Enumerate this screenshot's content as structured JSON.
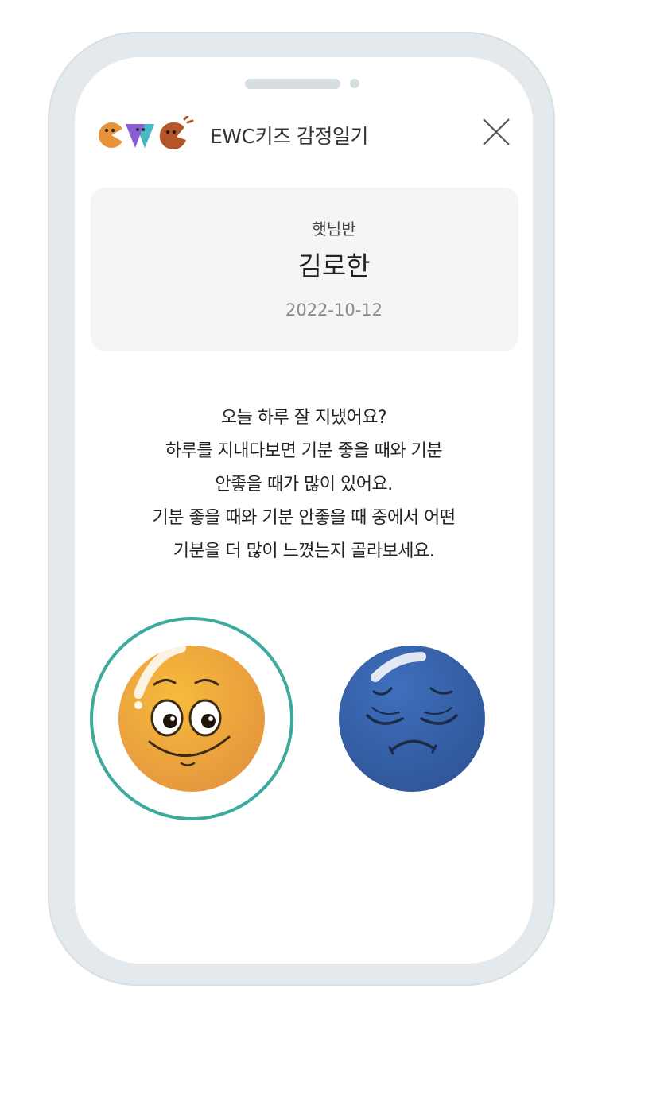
{
  "app": {
    "title": "EWC키즈 감정일기",
    "logo_text": "EWC"
  },
  "profile": {
    "class_name": "햇님반",
    "student_name": "김로한",
    "date": "2022-10-12"
  },
  "question_lines": [
    "오늘 하루 잘 지냈어요?",
    "하루를 지내다보면 기분 좋을 때와 기분",
    "안좋을 때가 많이 있어요.",
    "기분 좋을 때와 기분 안좋을 때 중에서 어떤",
    "기분을 더 많이 느꼈는지 골라보세요."
  ],
  "moods": [
    {
      "id": "good",
      "icon": "happy-face-icon",
      "selected": true,
      "color": "#f0a63a"
    },
    {
      "id": "bad",
      "icon": "sad-face-icon",
      "selected": false,
      "color": "#3a64ad"
    }
  ],
  "colors": {
    "selection_ring": "#3daa9d",
    "frame": "#e3e9ec",
    "card": "#f5f5f4"
  }
}
